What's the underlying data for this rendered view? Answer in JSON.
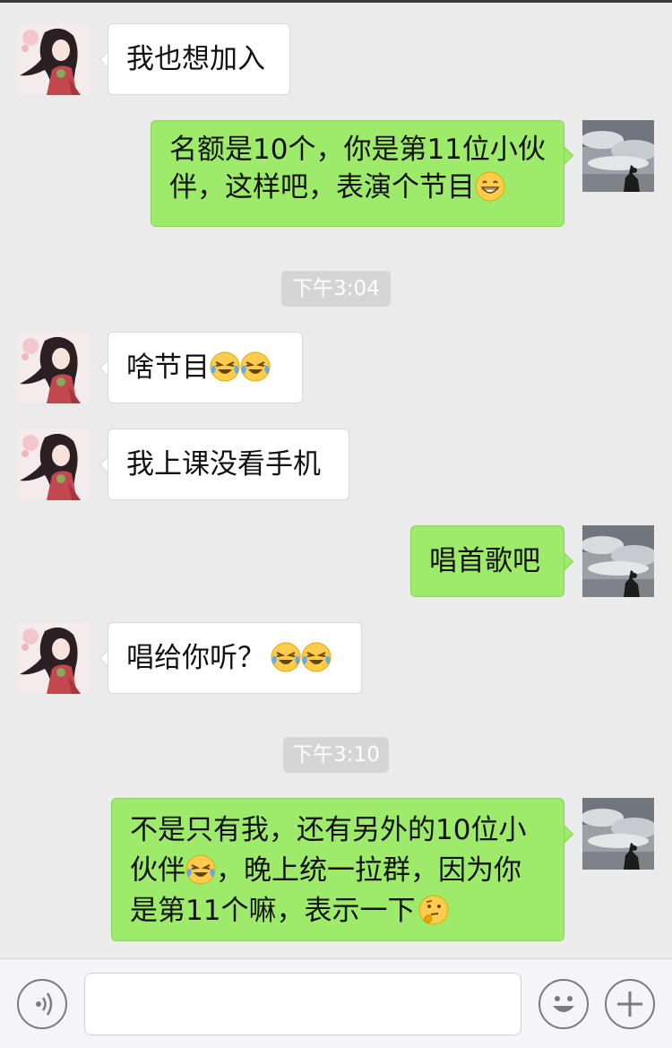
{
  "timestamps": [
    "下午3:04",
    "下午3:10"
  ],
  "messages": [
    {
      "side": "in",
      "text": "我也想加入"
    },
    {
      "side": "out",
      "line1": "名额是10个，你是第11位小伙",
      "line2": "伴，这样吧，表演个节目",
      "emoji": "grin-emoji"
    },
    {
      "side": "in",
      "text": "啥节目",
      "emoji": "crying-laughing-emoji"
    },
    {
      "side": "in",
      "text": "我上课没看手机"
    },
    {
      "side": "out",
      "text": "唱首歌吧"
    },
    {
      "side": "in",
      "text": "唱给你听？",
      "emoji": "crying-laughing-emoji"
    },
    {
      "side": "out",
      "line1": "不是只有我，还有另外的10位小",
      "line2a": "伙伴",
      "line2b": "，晚上统一拉群，因为你",
      "line3": "是第11个嘛，表示一下",
      "emoji1": "crying-laughing-emoji",
      "emoji2": "thinking-face-emoji"
    }
  ],
  "input": {
    "value": "",
    "voice_icon": "voice-icon",
    "emoji_icon": "smiley-icon",
    "more_icon": "plus-icon"
  },
  "colors": {
    "background": "#ebebeb",
    "outgoing_bubble": "#9eea6a",
    "incoming_bubble": "#ffffff",
    "timestamp_bg": "#d5d5d5"
  }
}
